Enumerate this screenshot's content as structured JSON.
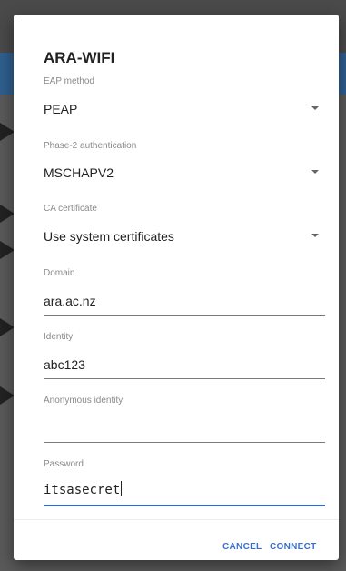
{
  "dialog": {
    "title": "ARA-WIFI",
    "eap_method": {
      "label": "EAP method",
      "value": "PEAP"
    },
    "phase2": {
      "label": "Phase-2 authentication",
      "value": "MSCHAPV2"
    },
    "ca_cert": {
      "label": "CA certificate",
      "value": "Use system certificates"
    },
    "domain": {
      "label": "Domain",
      "value": "ara.ac.nz"
    },
    "identity": {
      "label": "Identity",
      "value": "abc123"
    },
    "anon_identity": {
      "label": "Anonymous identity",
      "value": ""
    },
    "password": {
      "label": "Password",
      "value": "itsasecret"
    },
    "buttons": {
      "cancel": "CANCEL",
      "connect": "CONNECT"
    }
  },
  "colors": {
    "accent": "#3a6fd0",
    "focus_underline": "#3367d6"
  },
  "icons": {
    "dropdown": "arrow-drop-down-icon"
  }
}
